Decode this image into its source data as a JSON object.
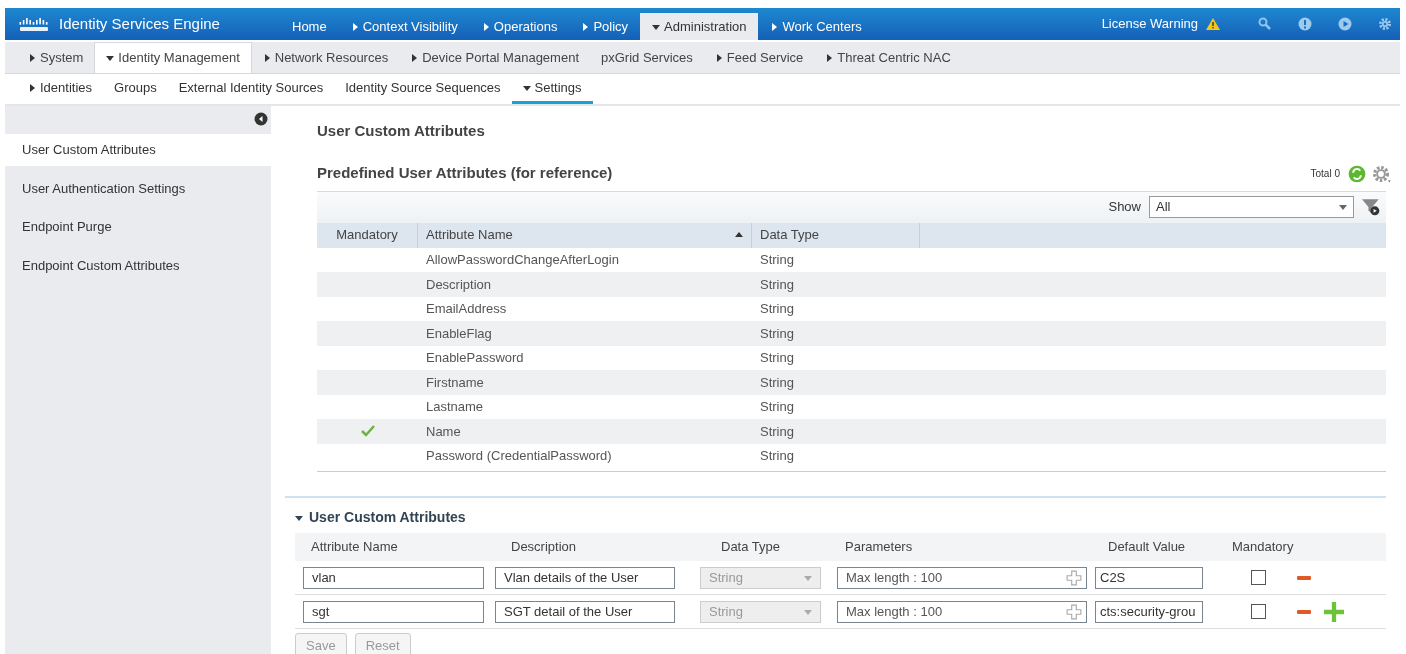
{
  "header": {
    "product": "Identity Services Engine",
    "license_warning": "License Warning"
  },
  "main_nav": [
    {
      "label": "Home",
      "kind": "link",
      "selected": false
    },
    {
      "label": "Context Visibility",
      "kind": "menu",
      "expanded": false,
      "selected": false
    },
    {
      "label": "Operations",
      "kind": "menu",
      "expanded": false,
      "selected": false
    },
    {
      "label": "Policy",
      "kind": "menu",
      "expanded": false,
      "selected": false
    },
    {
      "label": "Administration",
      "kind": "menu",
      "expanded": true,
      "selected": true
    },
    {
      "label": "Work Centers",
      "kind": "menu",
      "expanded": false,
      "selected": false
    }
  ],
  "sub_nav": [
    {
      "label": "System",
      "kind": "menu",
      "expanded": false,
      "selected": false
    },
    {
      "label": "Identity Management",
      "kind": "menu",
      "expanded": true,
      "selected": true
    },
    {
      "label": "Network Resources",
      "kind": "menu",
      "expanded": false,
      "selected": false
    },
    {
      "label": "Device Portal Management",
      "kind": "menu",
      "expanded": false,
      "selected": false
    },
    {
      "label": "pxGrid Services",
      "kind": "link",
      "selected": false
    },
    {
      "label": "Feed Service",
      "kind": "menu",
      "expanded": false,
      "selected": false
    },
    {
      "label": "Threat Centric NAC",
      "kind": "menu",
      "expanded": false,
      "selected": false
    }
  ],
  "third_nav": [
    {
      "label": "Identities",
      "kind": "menu",
      "expanded": false,
      "selected": false
    },
    {
      "label": "Groups",
      "kind": "link",
      "selected": false
    },
    {
      "label": "External Identity Sources",
      "kind": "link",
      "selected": false
    },
    {
      "label": "Identity Source Sequences",
      "kind": "link",
      "selected": false
    },
    {
      "label": "Settings",
      "kind": "menu",
      "expanded": true,
      "selected": true
    }
  ],
  "sidebar": {
    "items": [
      {
        "label": "User Custom Attributes",
        "selected": true
      },
      {
        "label": "User Authentication Settings",
        "selected": false
      },
      {
        "label": "Endpoint Purge",
        "selected": false
      },
      {
        "label": "Endpoint Custom Attributes",
        "selected": false
      }
    ]
  },
  "page_title": "User Custom Attributes",
  "predefined": {
    "title": "Predefined User Attributes (for reference)",
    "total": "Total 0",
    "show_label": "Show",
    "show_value": "All",
    "columns": [
      "Mandatory",
      "Attribute Name",
      "Data Type"
    ],
    "rows": [
      {
        "mandatory": false,
        "name": "AllowPasswordChangeAfterLogin",
        "type": "String"
      },
      {
        "mandatory": false,
        "name": "Description",
        "type": "String"
      },
      {
        "mandatory": false,
        "name": "EmailAddress",
        "type": "String"
      },
      {
        "mandatory": false,
        "name": "EnableFlag",
        "type": "String"
      },
      {
        "mandatory": false,
        "name": "EnablePassword",
        "type": "String"
      },
      {
        "mandatory": false,
        "name": "Firstname",
        "type": "String"
      },
      {
        "mandatory": false,
        "name": "Lastname",
        "type": "String"
      },
      {
        "mandatory": true,
        "name": "Name",
        "type": "String"
      },
      {
        "mandatory": false,
        "name": "Password (CredentialPassword)",
        "type": "String"
      }
    ]
  },
  "custom": {
    "title": "User Custom Attributes",
    "expanded": true,
    "columns": [
      "Attribute Name",
      "Description",
      "Data Type",
      "Parameters",
      "Default Value",
      "Mandatory"
    ],
    "rows": [
      {
        "name": "vlan",
        "description": "Vlan details of the User",
        "type": "String",
        "parameters": "Max length : 100",
        "default": "C2S",
        "mandatory": false
      },
      {
        "name": "sgt",
        "description": "SGT detail of the User",
        "type": "String",
        "parameters": "Max length : 100",
        "default": "cts:security-grou",
        "mandatory": false
      }
    ],
    "buttons": [
      {
        "label": "Save",
        "disabled": true
      },
      {
        "label": "Reset",
        "disabled": true
      }
    ]
  }
}
